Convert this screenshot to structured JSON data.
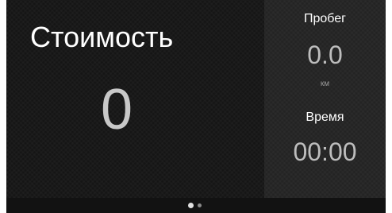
{
  "main": {
    "cost_label": "Стоимость",
    "cost_value": "0"
  },
  "side": {
    "mileage_label": "Пробег",
    "mileage_value": "0.0",
    "mileage_unit": "км",
    "time_label": "Время",
    "time_value": "00:00"
  },
  "pager": {
    "pages": 2,
    "active_page": 1
  },
  "colors": {
    "background": "#151515",
    "side_panel": "#232323",
    "primary_text": "#ffffff",
    "value_text": "#bdbdbd"
  }
}
